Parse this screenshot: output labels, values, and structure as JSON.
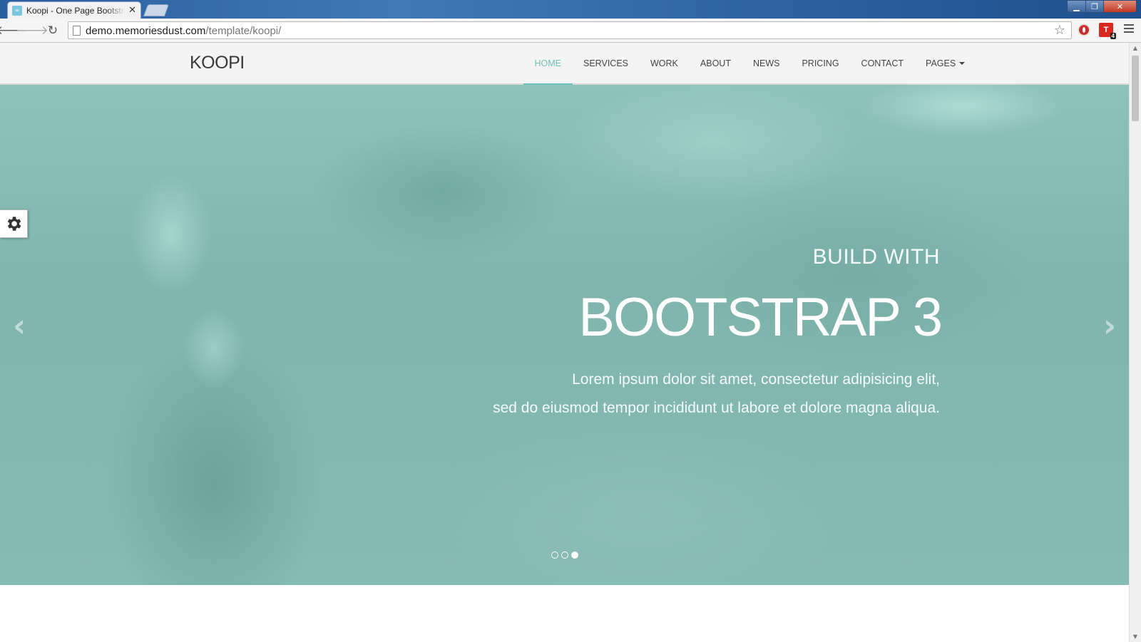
{
  "browser": {
    "tab_title": "Koopi - One Page Bootstrap",
    "tab_close": "✕",
    "url_domain": "demo.memoriesdust.com",
    "url_path": "/template/koopi/",
    "ext_badge": "4",
    "ext_label": "T"
  },
  "site": {
    "brand": "KOOPI",
    "nav": [
      {
        "label": "HOME",
        "active": true
      },
      {
        "label": "SERVICES"
      },
      {
        "label": "WORK"
      },
      {
        "label": "ABOUT"
      },
      {
        "label": "NEWS"
      },
      {
        "label": "PRICING"
      },
      {
        "label": "CONTACT"
      },
      {
        "label": "PAGES"
      }
    ]
  },
  "hero": {
    "subtitle": "BUILD WITH",
    "title": "BOOTSTRAP 3",
    "text_line1": "Lorem ipsum dolor sit amet, consectetur adipisicing elit,",
    "text_line2": "sed do eiusmod tempor incididunt ut labore et dolore magna aliqua.",
    "slides_count": 3,
    "active_slide": 3
  },
  "colors": {
    "accent": "#6fc2b8",
    "hero_bg": "#86bbb3"
  }
}
